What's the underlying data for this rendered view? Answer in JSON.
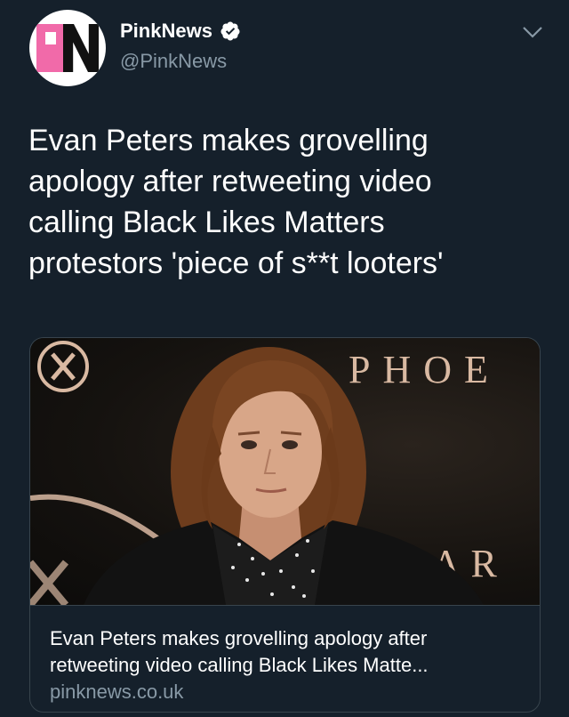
{
  "account": {
    "display_name": "PinkNews",
    "handle": "@PinkNews",
    "verified": true,
    "avatar_logo": "PN"
  },
  "tweet": {
    "text_lines": [
      "Evan Peters makes grovelling",
      "apology after retweeting video",
      "calling Black Likes Matters",
      "protestors 'piece of s**t looters'"
    ]
  },
  "card": {
    "title_lines": [
      "Evan Peters makes grovelling apology after",
      "retweeting video calling Black Likes Matte..."
    ],
    "domain": "pinknews.co.uk",
    "image": {
      "backdrop_text_top": "PHOE",
      "backdrop_text_bottom": "DAR",
      "backdrop_emblem": "X"
    }
  },
  "icons": {
    "verified": "verified-badge-icon",
    "menu": "chevron-down-icon"
  },
  "colors": {
    "background": "#15202b",
    "text_primary": "#ffffff",
    "text_secondary": "#8899a6",
    "border": "#38444d",
    "brand_pink": "#f16aa9"
  }
}
